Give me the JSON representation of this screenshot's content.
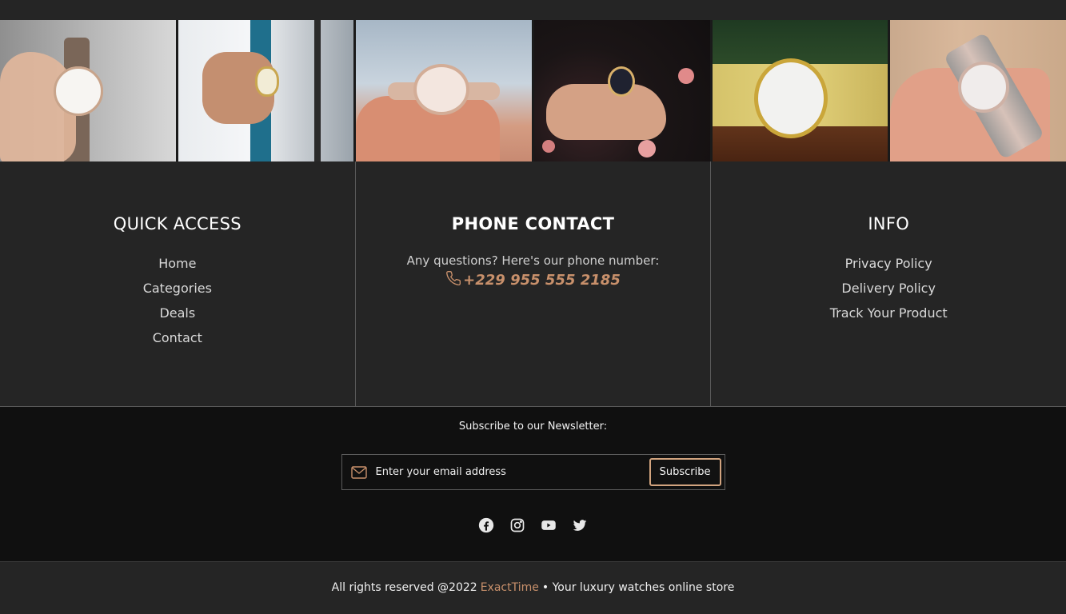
{
  "gallery": {
    "images": [
      {
        "alt": "Hand holding a leather-strap watch"
      },
      {
        "alt": "Man in suit wearing a gold watch"
      },
      {
        "alt": "Rose-gold watch on wrist"
      },
      {
        "alt": "Watch on floral sleeve"
      },
      {
        "alt": "Gold mesh watch on table"
      },
      {
        "alt": "Two-tone watch on wrist"
      }
    ]
  },
  "quick_access": {
    "title": "QUICK ACCESS",
    "links": [
      "Home",
      "Categories",
      "Deals",
      "Contact"
    ]
  },
  "phone_contact": {
    "title": "PHONE CONTACT",
    "text": "Any questions? Here's our phone number:",
    "phone": "+229 955 555 2185"
  },
  "info": {
    "title": "INFO",
    "links": [
      "Privacy Policy",
      "Delivery Policy",
      "Track Your Product"
    ]
  },
  "newsletter": {
    "title": "Subscribe to our Newsletter:",
    "placeholder": "Enter your email address",
    "button_label": "Subscribe"
  },
  "socials": [
    "facebook-icon",
    "instagram-icon",
    "youtube-icon",
    "twitter-icon"
  ],
  "footer": {
    "prefix": "All rights reserved @2022",
    "brand": "ExactTime",
    "suffix": "• Your luxury watches online store"
  },
  "colors": {
    "accent": "#c8906b",
    "background": "#252525",
    "newsletter_bg": "#101010"
  }
}
